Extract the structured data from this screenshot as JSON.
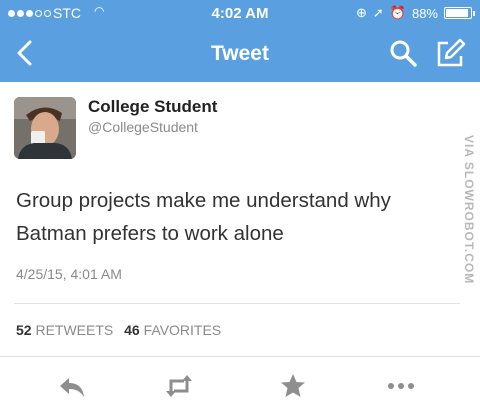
{
  "status_bar": {
    "carrier": "STC",
    "time": "4:02 AM",
    "battery": "88%",
    "signal_bars_filled": 3,
    "signal_bars_total": 5
  },
  "nav": {
    "title": "Tweet",
    "icons": [
      "back-chevron-icon",
      "search-icon",
      "compose-icon"
    ]
  },
  "tweet": {
    "name": "College Student",
    "handle": "@CollegeStudent",
    "text": "Group projects make me understand why Batman prefers to work alone",
    "timestamp": "4/25/15, 4:01 AM",
    "retweets": "52",
    "retweets_label": "RETWEETS",
    "favorites": "46",
    "favorites_label": "FAVORITES"
  },
  "actions": [
    "reply-icon",
    "retweet-icon",
    "favorite-icon",
    "more-icon"
  ],
  "watermark": "VIA SLOWROBOT.COM",
  "colors": {
    "header": "#5aa0e0",
    "text": "#333333",
    "muted": "#8a8a8a"
  }
}
